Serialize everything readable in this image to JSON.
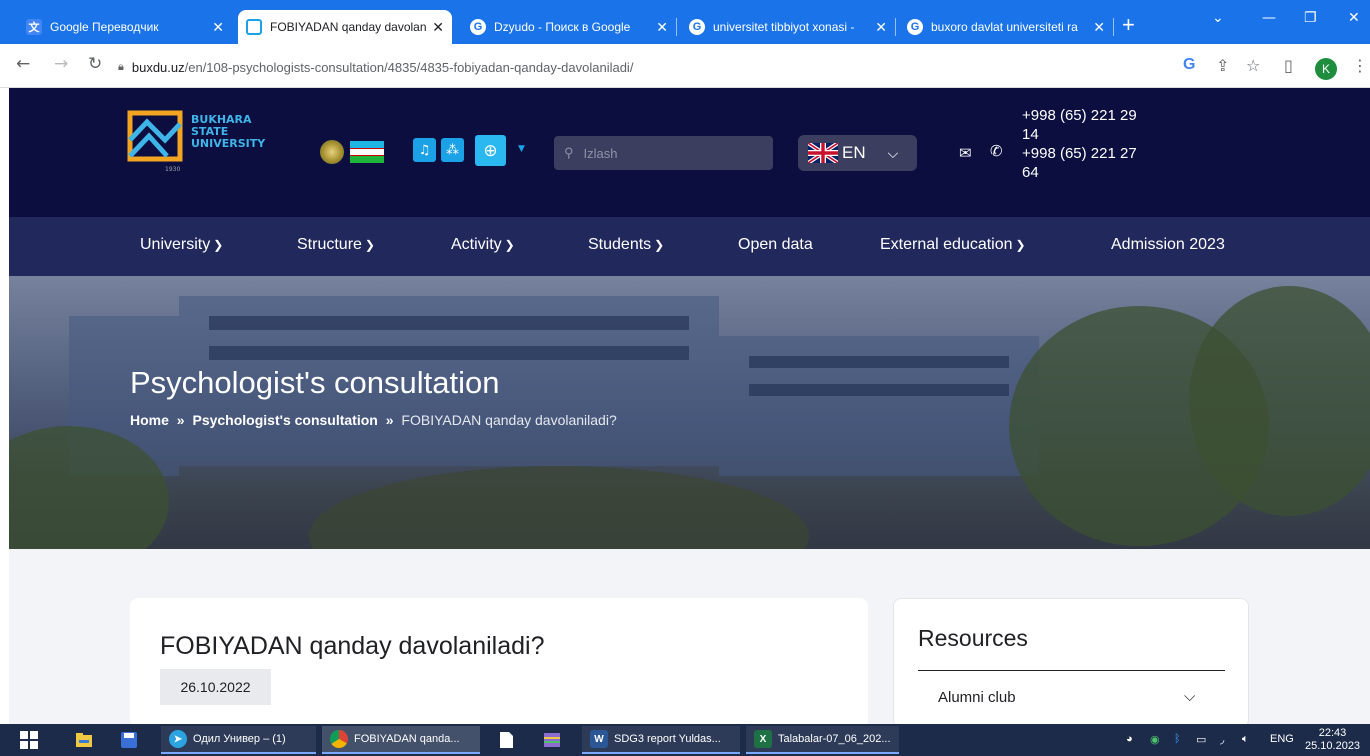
{
  "browser": {
    "tabs": [
      {
        "title": "Google Переводчик",
        "favicon": "google-translate-icon",
        "active": false
      },
      {
        "title": "FOBIYADAN qanday davolan",
        "favicon": "bsu-logo-icon",
        "active": true
      },
      {
        "title": "Dzyudo - Поиск в Google",
        "favicon": "google-icon",
        "active": false
      },
      {
        "title": "universitet tibbiyot xonasi -",
        "favicon": "google-icon",
        "active": false
      },
      {
        "title": "buxoro davlat universiteti ra",
        "favicon": "google-icon",
        "active": false
      }
    ],
    "close_glyph": "✕",
    "new_tab_glyph": "+",
    "url_host": "buxdu.uz",
    "url_path": "/en/108-psychologists-consultation/4835/4835-fobiyadan-qanday-davolaniladi/",
    "profile_initial": "K"
  },
  "site": {
    "logo": {
      "line1": "BUKHARA",
      "line2": "STATE",
      "line3": "UNIVERSITY",
      "year": "1930"
    },
    "search_placeholder": "Izlash",
    "language": "EN",
    "phones": [
      "+998 (65) 221 29",
      "14",
      "+998 (65) 221 27",
      "64"
    ],
    "nav": [
      {
        "label": "University",
        "dropdown": true
      },
      {
        "label": "Structure",
        "dropdown": true
      },
      {
        "label": "Activity",
        "dropdown": true
      },
      {
        "label": "Students",
        "dropdown": true
      },
      {
        "label": "Open data",
        "dropdown": false
      },
      {
        "label": "External education",
        "dropdown": true
      },
      {
        "label": "Admission 2023",
        "dropdown": false
      }
    ],
    "nav_chevron": "❯",
    "hero_title": "Psychologist's consultation",
    "breadcrumb": {
      "home": "Home",
      "section": "Psychologist's consultation",
      "current": "FOBIYADAN qanday davolaniladi?",
      "separator": "»"
    },
    "article": {
      "title": "FOBIYADAN qanday davolaniladi?",
      "date": "26.10.2022"
    },
    "sidebar": {
      "heading": "Resources",
      "items": [
        {
          "label": "Alumni club"
        }
      ]
    }
  },
  "taskbar": {
    "apps": [
      {
        "label": "Одил Универ – (1)"
      },
      {
        "label": "FOBIYADAN qanda..."
      },
      {
        "label": "SDG3 report Yuldas..."
      },
      {
        "label": "Talabalar-07_06_202..."
      }
    ],
    "lang": "ENG",
    "time": "22:43",
    "date": "25.10.2023"
  },
  "colors": {
    "chrome_blue": "#1a73e8",
    "header_navy": "#0b0e3f",
    "nav_blue": "#21285c",
    "accent_cyan": "#1aa1e6"
  }
}
